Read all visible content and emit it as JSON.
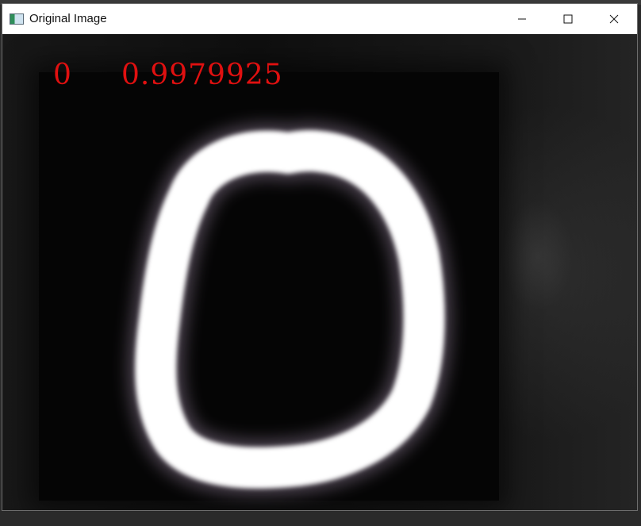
{
  "window": {
    "title": "Original Image",
    "icon": "opencv-window-icon",
    "controls": {
      "minimize_icon": "minimize-icon",
      "maximize_icon": "maximize-icon",
      "close_icon": "close-icon"
    }
  },
  "overlay": {
    "predicted_label": "0",
    "confidence": "0.9979925",
    "text_color": "#e01010"
  },
  "image": {
    "content": "handwritten-digit-zero",
    "stroke_color": "#ffffff",
    "background_color": "#050505"
  }
}
